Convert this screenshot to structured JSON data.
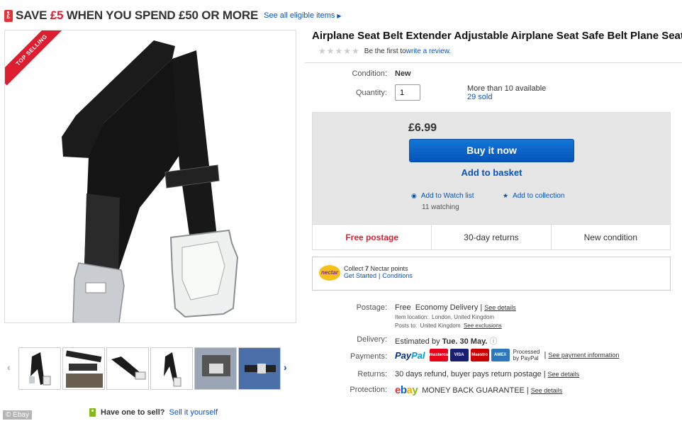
{
  "promo": {
    "text_prefix": "SAVE ",
    "amount": "£5",
    "text_suffix": " WHEN YOU SPEND £50 OR MORE",
    "link": "See all eligible items",
    "tag_glyph": "£"
  },
  "product_image": {
    "badge": "TOP SELLING"
  },
  "thumbnails": {
    "count": 6,
    "prev_icon": "chevron-left-icon",
    "next_icon": "chevron-right-icon"
  },
  "sell": {
    "question": "Have one to sell?",
    "link": "Sell it yourself"
  },
  "credit": "© Ebay",
  "item": {
    "title": "Airplane Seat Belt Extender Adjustable Airplane Seat Safe Belt Plane Seat",
    "rating_stars": 5,
    "review_prefix": "Be the first to ",
    "review_link": "write a review."
  },
  "details": {
    "condition_label": "Condition:",
    "condition_value": "New",
    "quantity_label": "Quantity:",
    "quantity_value": "1",
    "availability": "More than 10 available",
    "sold": "29 sold"
  },
  "buy": {
    "price": "£6.99",
    "buy_now": "Buy it now",
    "add_basket": "Add to basket",
    "watch": "Add to Watch list",
    "watching": "11 watching",
    "collection": "Add to collection"
  },
  "features": [
    "Free postage",
    "30-day returns",
    "New condition"
  ],
  "nectar": {
    "logo": "nectar",
    "collect_prefix": "Collect ",
    "points": "7",
    "collect_suffix": " Nectar points",
    "get_started": "Get Started",
    "conditions": "Conditions"
  },
  "postage": {
    "label": "Postage:",
    "free": "Free",
    "method": "Economy Delivery",
    "see_details": "See details",
    "location_label": "Item location:",
    "location": "London, United Kingdom",
    "posts_label": "Posts to:",
    "posts_to": "United Kingdom",
    "see_exclusions": "See exclusions"
  },
  "delivery": {
    "label": "Delivery:",
    "prefix": "Estimated by ",
    "date": "Tue. 30 May."
  },
  "payments": {
    "label": "Payments:",
    "paypal_a": "Pay",
    "paypal_b": "Pal",
    "cards": [
      {
        "name": "mastercard",
        "color": "#eb001b"
      },
      {
        "name": "VISA",
        "color": "#1a1f71"
      },
      {
        "name": "Maestro",
        "color": "#cc0000"
      },
      {
        "name": "AMEX",
        "color": "#2e77bc"
      }
    ],
    "processed_1": "Processed",
    "processed_2": "by PayPal",
    "see_info": "See payment information"
  },
  "returns": {
    "label": "Returns:",
    "text": "30 days refund, buyer pays return postage",
    "see_details": "See details"
  },
  "protection": {
    "label": "Protection:",
    "guarantee": "MONEY BACK GUARANTEE",
    "see_details": "See details"
  }
}
